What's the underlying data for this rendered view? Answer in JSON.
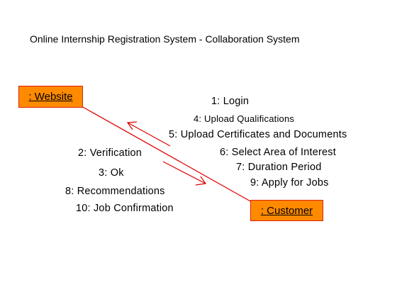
{
  "diagram": {
    "title": "Online Internship Registration System - Collaboration System",
    "objects": {
      "website": ": Website",
      "customer": ": Customer"
    },
    "messages_to_website": [
      "1: Login",
      "4: Upload Qualifications",
      "5: Upload Certificates and Documents",
      "6: Select Area of Interest",
      "7: Duration Period",
      "9: Apply for Jobs"
    ],
    "messages_to_customer": [
      "2: Verification",
      "3: Ok",
      "8: Recommendations",
      "10: Job Confirmation"
    ],
    "colors": {
      "object_fill": "#ff8a00",
      "object_border": "#e02000",
      "link_line": "#e00000",
      "arrow": "#e00000"
    }
  }
}
